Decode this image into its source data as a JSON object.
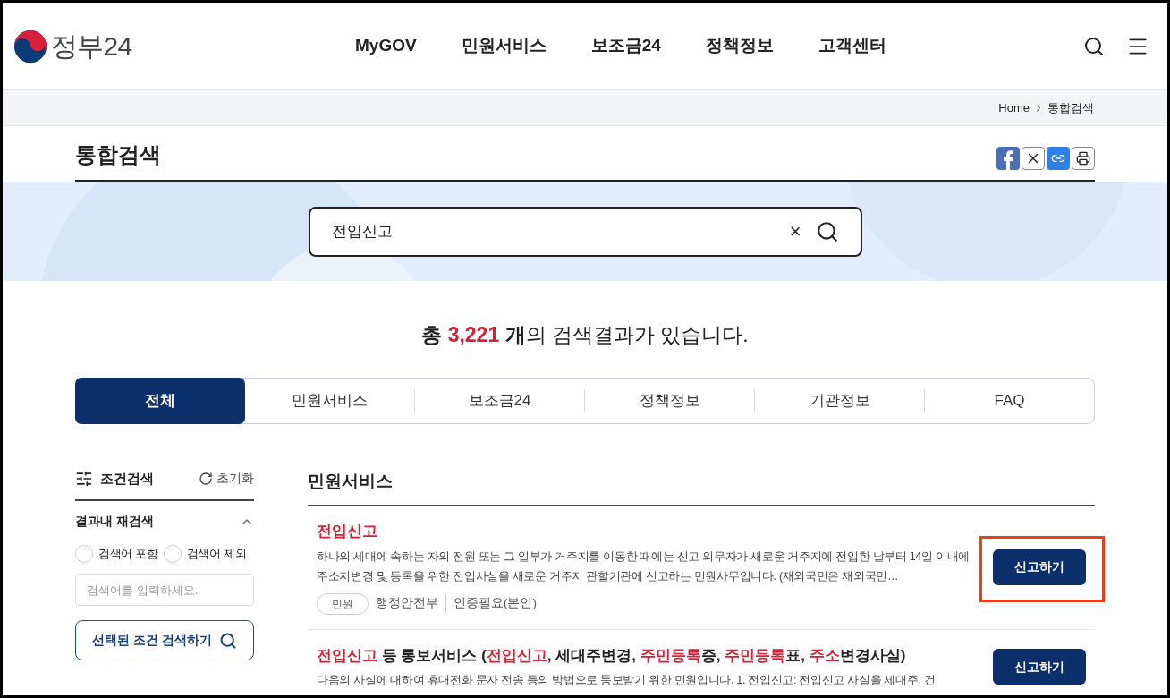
{
  "header": {
    "logo_text": "정부24",
    "nav": [
      "MyGOV",
      "민원서비스",
      "보조금24",
      "정책정보",
      "고객센터"
    ]
  },
  "breadcrumb": [
    "Home",
    "통합검색"
  ],
  "page_title": "통합검색",
  "search": {
    "value": "전입신고",
    "clear": "×"
  },
  "summary": {
    "prefix": "총 ",
    "count": "3,221",
    "suffix": " 개의 검색결과가 있습니다."
  },
  "tabs": [
    {
      "label": "전체",
      "selected": true
    },
    {
      "label": "민원서비스",
      "selected": false
    },
    {
      "label": "보조금24",
      "selected": false
    },
    {
      "label": "정책정보",
      "selected": false
    },
    {
      "label": "기관정보",
      "selected": false
    },
    {
      "label": "FAQ",
      "selected": false
    }
  ],
  "sidebar": {
    "title": "조건검색",
    "reset": "초기화",
    "section": "결과내 재검색",
    "expanded": true,
    "options": [
      {
        "label": "검색어 포함",
        "selected": false
      },
      {
        "label": "검색어 제외",
        "selected": false
      }
    ],
    "placeholder": "검색어를 입력하세요.",
    "submit": "선택된 조건 검색하기"
  },
  "results": {
    "heading": "민원서비스",
    "items": [
      {
        "title": [
          {
            "text": "전입신고",
            "highlight": true
          }
        ],
        "desc": "하나의 세대에 속하는 자의 전원 또는 그 일부가 거주지를 이동한 때에는 신고 의무자가 새로운 거주지에 전입한 날부터 14일 이내에 주소지변경 및 등록을 위한 전입사실을 새로운 거주지 관할기관에 신고하는 민원사무입니다. (재외국민은 재외국민…",
        "tag": "민원",
        "meta": [
          "행정안전부",
          "인증필요(본인)"
        ],
        "button": "신고하기",
        "marked": true
      },
      {
        "title": [
          {
            "text": "전입신고",
            "highlight": true
          },
          {
            "text": " 등 통보서비스 (",
            "highlight": false
          },
          {
            "text": "전입신고",
            "highlight": true
          },
          {
            "text": ", 세대주변경, ",
            "highlight": false
          },
          {
            "text": "주민등록",
            "highlight": true
          },
          {
            "text": "증, ",
            "highlight": false
          },
          {
            "text": "주민등록",
            "highlight": true
          },
          {
            "text": "표, ",
            "highlight": false
          },
          {
            "text": "주소",
            "highlight": true
          },
          {
            "text": "변경사실)",
            "highlight": false
          }
        ],
        "desc": "다음의 사실에 대하여 휴대전화 문자 전송 등의 방법으로 통보받기 위한 민원입니다. 1. 전입신고: 전입신고 사실을 세대주, 건",
        "button": "신고하기",
        "marked": false
      }
    ]
  }
}
